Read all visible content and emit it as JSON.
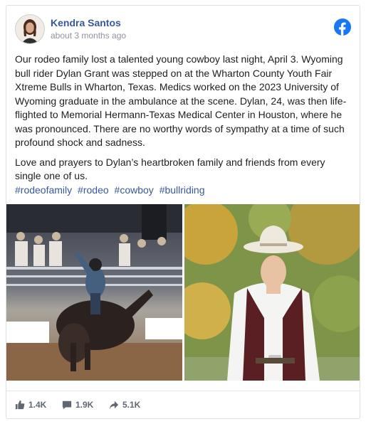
{
  "post": {
    "author": "Kendra Santos",
    "time": "about 3 months ago",
    "paragraphs": [
      "Our rodeo family lost a talented young cowboy last night, April 3. Wyoming bull rider Dylan Grant was stepped on at the Wharton County Youth Fair Xtreme Bulls in Wharton, Texas. Medics worked on the 2023 University of Wyoming graduate in the ambulance at the scene. Dylan, 24, was then life-flighted to Memorial Hermann-Texas Medical Center in Houston, where he was pronounced. There are no worthy words of sympathy at a time of such profound shock and sadness.",
      "Love and prayers to Dylan’s heartbroken family and friends from every single one of us."
    ],
    "hashtags": [
      "#rodeofamily",
      "#rodeo",
      "#cowboy",
      "#bullriding"
    ]
  },
  "stats": {
    "likes": "1.4K",
    "comments": "1.9K",
    "shares": "5.1K"
  },
  "colors": {
    "brand": "#1877f2",
    "link": "#365899"
  }
}
